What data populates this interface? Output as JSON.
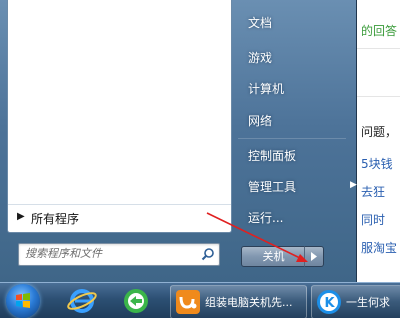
{
  "background_page": {
    "lines": [
      "的回答",
      "问题，",
      "5块钱",
      "去狂",
      "同时",
      "服淘宝"
    ]
  },
  "start_menu": {
    "all_programs_label": "所有程序",
    "search_placeholder": "搜索程序和文件",
    "right_items": [
      "文档",
      "游戏",
      "计算机",
      "网络",
      "控制面板",
      "管理工具",
      "运行..."
    ],
    "shutdown_label": "关机"
  },
  "taskbar": {
    "windows": [
      {
        "label": "组装电脑关机先..."
      },
      {
        "label": "一生何求"
      }
    ]
  },
  "colors": {
    "annotation_arrow": "#e02020",
    "link_blue": "#2a5fb0",
    "link_green": "#3a9b3a"
  }
}
